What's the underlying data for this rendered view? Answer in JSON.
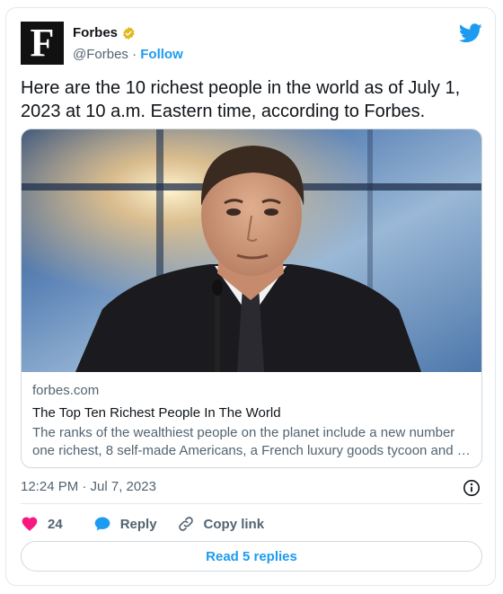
{
  "author": {
    "name": "Forbes",
    "handle": "@Forbes",
    "separator": "·",
    "follow_label": "Follow",
    "avatar_letter": "F"
  },
  "tweet": {
    "text": "Here are the 10 richest people in the world as of July 1, 2023 at 10 a.m. Eastern time, according to Forbes.",
    "timestamp": "12:24 PM · Jul 7, 2023"
  },
  "link_card": {
    "domain": "forbes.com",
    "title": "The Top Ten Richest People In The World",
    "description_line1": "The ranks of the wealthiest people on the planet include a new number",
    "description_line2": "one richest, 8 self-made Americans, a French luxury goods tycoon and …"
  },
  "actions": {
    "like_count": "24",
    "reply_label": "Reply",
    "copy_link_label": "Copy link",
    "read_replies_label": "Read 5 replies"
  },
  "colors": {
    "accent": "#1d9bf0",
    "like": "#f91880",
    "muted": "#536471",
    "badge": "#e2b719"
  },
  "icons": [
    "verified-badge-icon",
    "twitter-bird-icon",
    "info-icon",
    "heart-icon",
    "reply-bubble-icon",
    "link-icon"
  ]
}
